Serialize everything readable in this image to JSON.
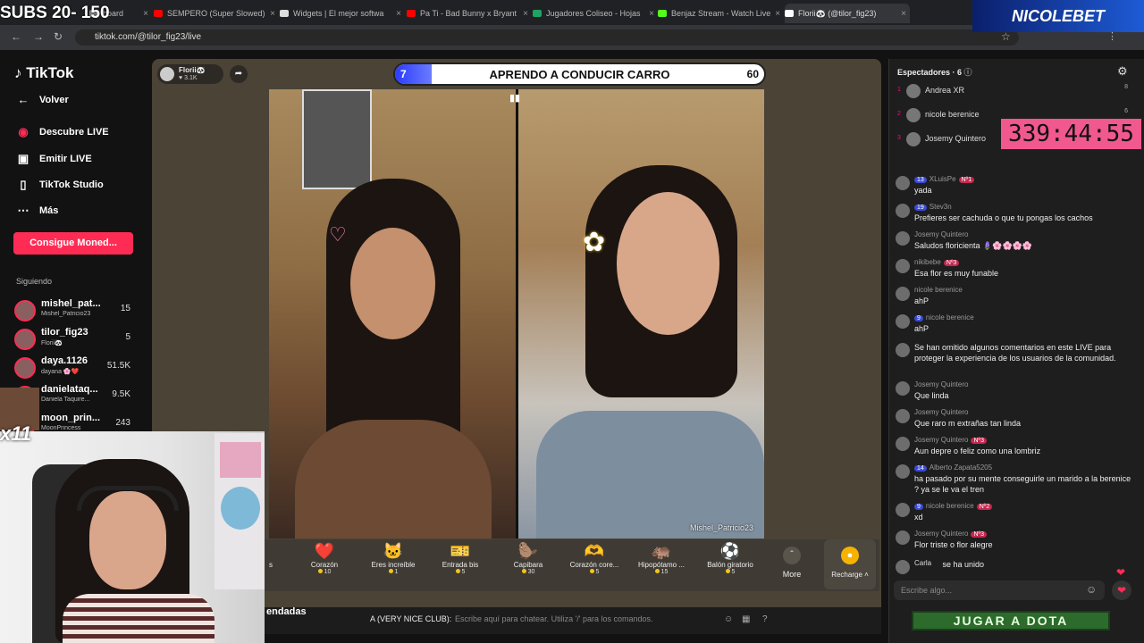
{
  "overlay": {
    "subs": "SUBS 20- 150",
    "brand": "NICOLEBET",
    "timer": "339:44:55",
    "multiplier": "x11",
    "jugar": "JUGAR A DOTA"
  },
  "browser": {
    "tabs": [
      {
        "title": "board",
        "color": "#888888"
      },
      {
        "title": "SEMPERO (Super Slowed)",
        "color": "#ff0000"
      },
      {
        "title": "Widgets | El mejor softwa",
        "color": "#dddddd"
      },
      {
        "title": "Pa Ti - Bad Bunny x Bryant",
        "color": "#ff0000"
      },
      {
        "title": "Jugadores Coliseo - Hojas",
        "color": "#1ea362"
      },
      {
        "title": "Benjaz Stream - Watch Live",
        "color": "#53fc18"
      },
      {
        "title": "Florii🐼 (@tilor_fig23)",
        "color": "#ffffff"
      }
    ],
    "url": "tiktok.com/@tilor_fig23/live"
  },
  "sidebar": {
    "logo": "TikTok",
    "back": "Volver",
    "nav": [
      "Descubre LIVE",
      "Emitir LIVE",
      "TikTok Studio",
      "Más"
    ],
    "coins_button": "Consigue Moned...",
    "following_header": "Siguiendo",
    "accounts": [
      {
        "name": "mishel_pat...",
        "handle": "Mishel_Patricio23",
        "count": "15"
      },
      {
        "name": "tilor_fig23",
        "handle": "Florii🐼",
        "count": "5"
      },
      {
        "name": "daya.1126",
        "handle": "dayana 🌸❤️",
        "count": "51.5K"
      },
      {
        "name": "danielataq...",
        "handle": "Daniela Taquire...",
        "count": "9.5K"
      },
      {
        "name": "moon_prin...",
        "handle": "MoonPrincess",
        "count": "243"
      }
    ]
  },
  "stream": {
    "streamer_name": "Florii🐼",
    "streamer_likes": "♥ 3.1K",
    "battle": {
      "left_score": "7",
      "title": "APRENDO A CONDUCIR CARRO",
      "right_score": "60",
      "left_share": 0.1
    },
    "watermark": "Mishel_Patricio23",
    "gifts": [
      {
        "name": "s",
        "price": "",
        "glyph": ""
      },
      {
        "name": "Corazón",
        "price": "10",
        "glyph": "❤️"
      },
      {
        "name": "Eres increíble",
        "price": "1",
        "glyph": "🐱"
      },
      {
        "name": "Entrada bis",
        "price": "5",
        "glyph": "🎫"
      },
      {
        "name": "Capibara",
        "price": "30",
        "glyph": "🦫"
      },
      {
        "name": "Corazón core...",
        "price": "5",
        "glyph": "🫶"
      },
      {
        "name": "Hipopótamo ...",
        "price": "15",
        "glyph": "🦛"
      },
      {
        "name": "Balón giratorio",
        "price": "5",
        "glyph": "⚽"
      }
    ],
    "more_label": "More",
    "recharge_label": "Recharge ˄",
    "recommended_label": "endadas",
    "chatbar_name": "A (VERY NICE CLUB):",
    "chatbar_placeholder": "Escribe aquí para chatear. Utiliza '/' para los comandos."
  },
  "chat": {
    "spectators_label": "Espectadores · 6",
    "top_viewers": [
      {
        "rank": "1",
        "name": "Andrea XR",
        "score": "8"
      },
      {
        "rank": "2",
        "name": "nicole berenice",
        "score": "6"
      },
      {
        "rank": "3",
        "name": "Josemy Quintero",
        "score": ""
      }
    ],
    "messages": [
      {
        "level": "13",
        "user": "XLuisPe",
        "rank": "Nº1",
        "text": "yada"
      },
      {
        "level": "19",
        "user": "Stev3n",
        "rank": "",
        "text": "Prefieres ser cachuda o que tu pongas los cachos"
      },
      {
        "level": "",
        "user": "Josemy Quintero",
        "rank": "",
        "text": "Saludos floricienta 🪻🌸🌸🌸🌸"
      },
      {
        "level": "",
        "user": "nikibebe",
        "rank": "Nº3",
        "text": "Esa flor es muy funable"
      },
      {
        "level": "",
        "user": "nicole berenice",
        "rank": "",
        "text": "ahP"
      },
      {
        "level": "9",
        "user": "nicole berenice",
        "rank": "",
        "text": "ahP"
      },
      {
        "level": "",
        "user": "",
        "rank": "",
        "text": "Se han omitido algunos comentarios en este LIVE para proteger la experiencia de los usuarios de la comunidad."
      },
      {
        "level": "",
        "user": "Josemy Quintero",
        "rank": "",
        "text": "Que linda"
      },
      {
        "level": "",
        "user": "Josemy Quintero",
        "rank": "",
        "text": "Que raro m extrañas tan linda"
      },
      {
        "level": "",
        "user": "Josemy Quintero",
        "rank": "Nº3",
        "text": "Aun depre o feliz como una lombriz"
      },
      {
        "level": "14",
        "user": "Alberto Zapata5205",
        "rank": "",
        "text": "ha pasado por su mente conseguirle un marido a la berenice ? ya se le va el tren"
      },
      {
        "level": "9",
        "user": "nicole berenice",
        "rank": "Nº2",
        "text": "xd"
      },
      {
        "level": "",
        "user": "Josemy Quintero",
        "rank": "Nº3",
        "text": "Flor triste o flor alegre"
      },
      {
        "level": "",
        "user": "Carla",
        "rank": "",
        "text": "se ha unido"
      }
    ],
    "input_placeholder": "Escribe algo..."
  }
}
